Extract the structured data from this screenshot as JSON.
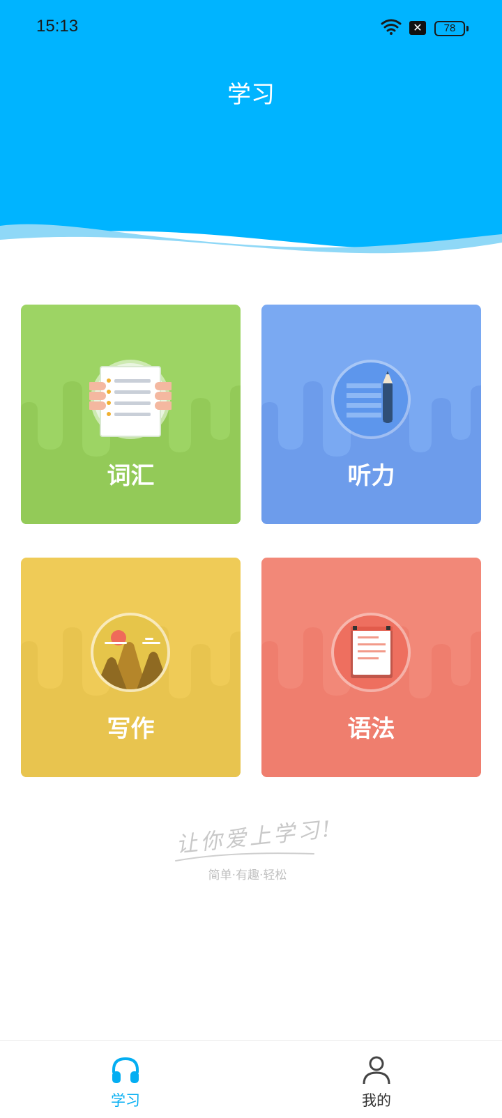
{
  "status_bar": {
    "time": "15:13",
    "battery": "78",
    "notification_badge": "✕"
  },
  "header": {
    "title": "学习"
  },
  "cards": [
    {
      "label": "词汇",
      "icon": "vocabulary-notepad-icon",
      "color": "#9dd464"
    },
    {
      "label": "听力",
      "icon": "listening-pencil-icon",
      "color": "#7aa9f2"
    },
    {
      "label": "写作",
      "icon": "writing-mountain-icon",
      "color": "#efcb57"
    },
    {
      "label": "语法",
      "icon": "grammar-clipboard-icon",
      "color": "#f28878"
    }
  ],
  "slogan": {
    "main": "让你爱上学习!",
    "sub": "简单·有趣·轻松"
  },
  "tabbar": {
    "items": [
      {
        "label": "学习",
        "icon": "headphones-icon",
        "active": true
      },
      {
        "label": "我的",
        "icon": "person-icon",
        "active": false
      }
    ]
  },
  "colors": {
    "header_blue": "#00b4ff",
    "active_tab": "#04aef2"
  }
}
